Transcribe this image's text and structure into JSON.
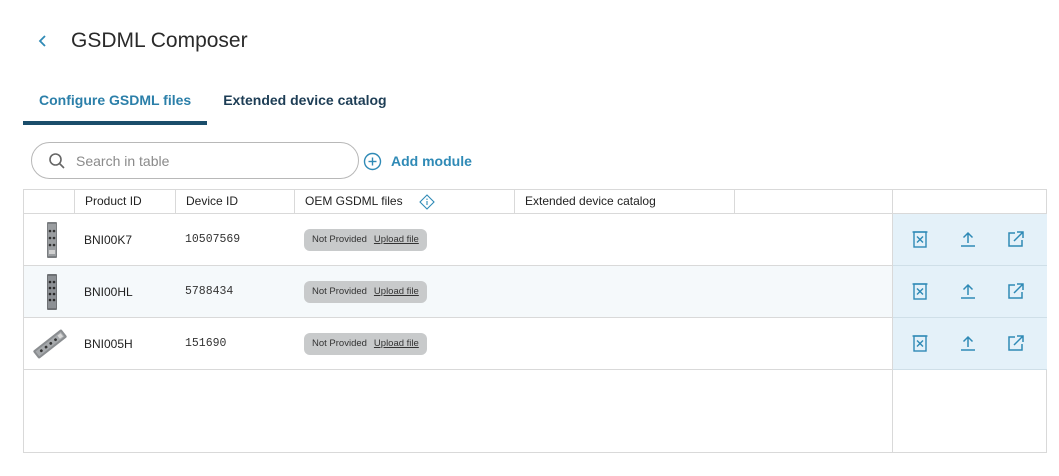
{
  "header": {
    "title": "GSDML Composer",
    "back_icon": "chevron-left-icon"
  },
  "tabs": [
    {
      "label": "Configure GSDML files",
      "active": true
    },
    {
      "label": "Extended device catalog",
      "active": false
    }
  ],
  "search": {
    "placeholder": "Search in table",
    "value": ""
  },
  "add_module": {
    "label": "Add module"
  },
  "table": {
    "columns": [
      "",
      "Product ID",
      "Device ID",
      "OEM GSDML files",
      "Extended device catalog",
      ""
    ],
    "rows": [
      {
        "product_id": "BNI00K7",
        "device_id": "10507569",
        "oem_status": "Not Provided",
        "oem_action": "Upload file",
        "extended_catalog": ""
      },
      {
        "product_id": "BNI00HL",
        "device_id": "5788434",
        "oem_status": "Not Provided",
        "oem_action": "Upload file",
        "extended_catalog": ""
      },
      {
        "product_id": "BNI005H",
        "device_id": "151690",
        "oem_status": "Not Provided",
        "oem_action": "Upload file",
        "extended_catalog": ""
      }
    ],
    "row_actions": [
      "delete-icon",
      "upload-icon",
      "open-external-icon"
    ]
  },
  "colors": {
    "accent": "#2b7fa9",
    "tab_underline": "#1a4d6b",
    "action_bg": "#e4f1f9",
    "pill_bg": "#c8cacb"
  }
}
